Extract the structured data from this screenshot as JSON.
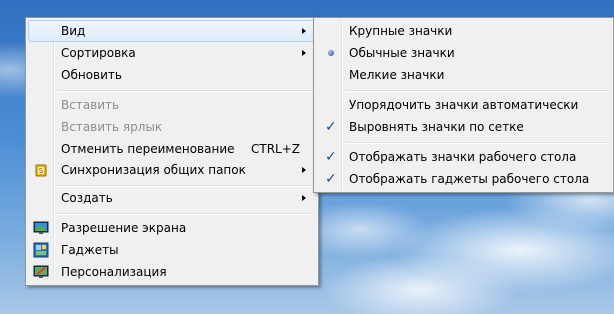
{
  "main_menu": {
    "view": "Вид",
    "sort": "Сортировка",
    "refresh": "Обновить",
    "paste": "Вставить",
    "paste_shortcut": "Вставить ярлык",
    "undo_rename": "Отменить переименование",
    "undo_shortcut": "CTRL+Z",
    "sync_shared": "Синхронизация общих папок",
    "create": "Создать",
    "screen_resolution": "Разрешение экрана",
    "gadgets": "Гаджеты",
    "personalize": "Персонализация"
  },
  "view_submenu": {
    "large_icons": "Крупные значки",
    "medium_icons": "Обычные значки",
    "small_icons": "Мелкие значки",
    "auto_arrange": "Упорядочить значки автоматически",
    "align_grid": "Выровнять значки по сетке",
    "show_icons": "Отображать значки рабочего стола",
    "show_gadgets": "Отображать гаджеты  рабочего стола",
    "state": {
      "selected_size": "medium_icons",
      "align_grid_checked": true,
      "show_icons_checked": true,
      "show_gadgets_checked": true
    }
  },
  "colors": {
    "menu_bg": "#f0f0f0",
    "hover_border": "#aecff7",
    "disabled_text": "#8d8d8d"
  }
}
